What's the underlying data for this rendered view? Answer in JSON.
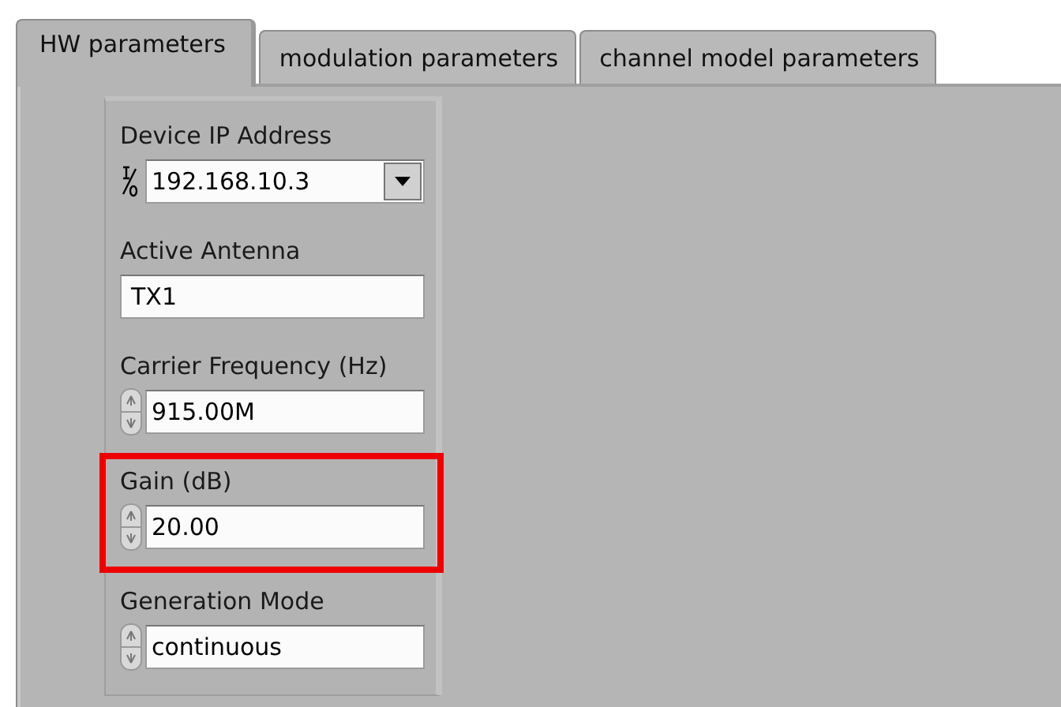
{
  "tabs": [
    {
      "label": "HW parameters",
      "selected": true
    },
    {
      "label": "modulation parameters",
      "selected": false
    },
    {
      "label": "channel model parameters",
      "selected": false
    }
  ],
  "controls": [
    {
      "kind": "ip",
      "label": "Device IP Address",
      "value": "192.168.10.3",
      "highlighted": false
    },
    {
      "kind": "string",
      "label": "Active Antenna",
      "value": "TX1",
      "highlighted": false
    },
    {
      "kind": "numeric",
      "label": "Carrier Frequency (Hz)",
      "value": "915.00M",
      "highlighted": false
    },
    {
      "kind": "numeric",
      "label": "Gain (dB)",
      "value": "20.00",
      "highlighted": true
    },
    {
      "kind": "ring",
      "label": "Generation Mode",
      "value": "continuous",
      "highlighted": false
    }
  ]
}
